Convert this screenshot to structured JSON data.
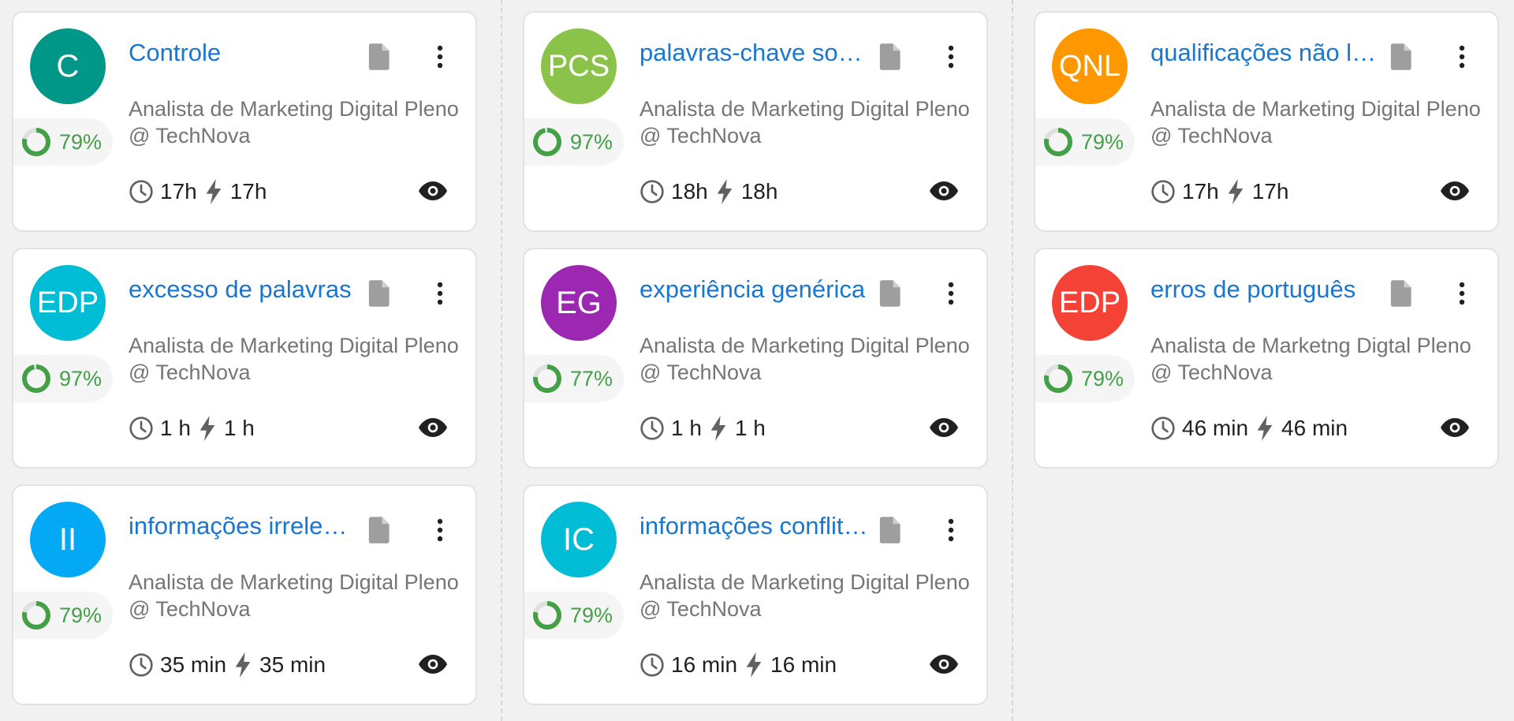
{
  "columns": [
    {
      "cards": [
        {
          "initials": "C",
          "color": "#009688",
          "title": "Controle",
          "score": "79%",
          "score_fraction": 0.79,
          "subtitle": "Analista de Marketing Digital Pleno",
          "company": "@ TechNova",
          "time": "17h",
          "speed": "17h"
        },
        {
          "initials": "EDP",
          "color": "#00bcd4",
          "title": "excesso de palavras",
          "score": "97%",
          "score_fraction": 0.97,
          "subtitle": "Analista de Marketing Digital Pleno",
          "company": "@ TechNova",
          "time": "1 h",
          "speed": "1 h"
        },
        {
          "initials": "II",
          "color": "#03a9f4",
          "title": "informações irrelevantes",
          "score": "79%",
          "score_fraction": 0.79,
          "subtitle": "Analista de Marketing Digital Pleno",
          "company": "@ TechNova",
          "time": "35 min",
          "speed": "35 min"
        }
      ]
    },
    {
      "cards": [
        {
          "initials": "PCS",
          "color": "#8bc34a",
          "title": "palavras-chave sobrecarregadas",
          "score": "97%",
          "score_fraction": 0.97,
          "subtitle": "Analista de Marketing Digital Pleno",
          "company": "@ TechNova",
          "time": "18h",
          "speed": "18h"
        },
        {
          "initials": "EG",
          "color": "#9c27b0",
          "title": "experiência genérica",
          "score": "77%",
          "score_fraction": 0.77,
          "subtitle": "Analista de Marketing Digital Pleno",
          "company": "@ TechNova",
          "time": "1 h",
          "speed": "1 h"
        },
        {
          "initials": "IC",
          "color": "#00bcd4",
          "title": "informações conflitantes",
          "score": "79%",
          "score_fraction": 0.79,
          "subtitle": "Analista de Marketing Digital Pleno",
          "company": "@ TechNova",
          "time": "16 min",
          "speed": "16 min"
        }
      ]
    },
    {
      "cards": [
        {
          "initials": "QNL",
          "color": "#ff9800",
          "title": "qualificações não listadas",
          "score": "79%",
          "score_fraction": 0.79,
          "subtitle": "Analista de Marketing Digital Pleno",
          "company": "@ TechNova",
          "time": "17h",
          "speed": "17h"
        },
        {
          "initials": "EDP",
          "color": "#f44336",
          "title": "erros de português",
          "score": "79%",
          "score_fraction": 0.79,
          "subtitle": "Analista de Marketng Digtal Pleno",
          "company": "@ TechNova",
          "time": "46 min",
          "speed": "46 min"
        }
      ]
    }
  ]
}
